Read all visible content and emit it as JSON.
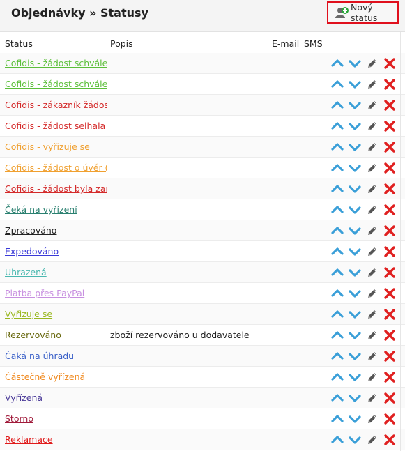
{
  "header": {
    "title": "Objednávky » Statusy",
    "new_status_label": "Nový status"
  },
  "table": {
    "columns": {
      "status": "Status",
      "description": "Popis",
      "email": "E-mail",
      "sms": "SMS"
    },
    "rows": [
      {
        "status": "Cofidis - žádost schválena",
        "color": "#5cbf3a",
        "description": ""
      },
      {
        "status": "Cofidis - žádost schválena",
        "color": "#5cbf3a",
        "description": ""
      },
      {
        "status": "Cofidis - zákazník žádost",
        "color": "#d42a2a",
        "description": ""
      },
      {
        "status": "Cofidis - žádost selhala",
        "color": "#d42a2a",
        "description": ""
      },
      {
        "status": "Cofidis - vyřizuje se",
        "color": "#f0a030",
        "description": ""
      },
      {
        "status": "Cofidis - žádost o úvěr (",
        "color": "#f0a030",
        "description": ""
      },
      {
        "status": "Cofidis - žádost byla zam",
        "color": "#d42a2a",
        "description": ""
      },
      {
        "status": "Čeká na vyřízení",
        "color": "#2a8070",
        "description": ""
      },
      {
        "status": "Zpracováno",
        "color": "#222222",
        "description": ""
      },
      {
        "status": "Expedováno",
        "color": "#3a3ad8",
        "description": ""
      },
      {
        "status": "Uhrazená",
        "color": "#4ab8b0",
        "description": ""
      },
      {
        "status": "Platba přes PayPal",
        "color": "#c890e0",
        "description": ""
      },
      {
        "status": "Vyřizuje se",
        "color": "#9ab820",
        "description": ""
      },
      {
        "status": "Rezervováno",
        "color": "#6a6a10",
        "description": "zboží rezervováno u dodavatele"
      },
      {
        "status": "Čaká na úhradu",
        "color": "#3a60c8",
        "description": ""
      },
      {
        "status": "Částečně vyřízená",
        "color": "#f08a20",
        "description": ""
      },
      {
        "status": "Vyřízená",
        "color": "#4a3a98",
        "description": ""
      },
      {
        "status": "Storno",
        "color": "#a01a3a",
        "description": ""
      },
      {
        "status": "Reklamace",
        "color": "#e01a1a",
        "description": ""
      }
    ]
  },
  "icons": {
    "up": "arrow-up-icon",
    "down": "arrow-down-icon",
    "edit": "pencil-icon",
    "delete": "delete-x-icon"
  },
  "colors": {
    "accent_blue": "#3a9fd8",
    "delete_red": "#e02020",
    "highlight_border": "#e0101d"
  }
}
